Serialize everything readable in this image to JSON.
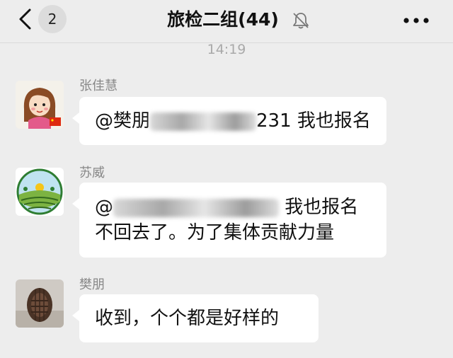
{
  "header": {
    "back_icon": "chevron-left-icon",
    "unread_count": "2",
    "title": "旅检二组(44)",
    "mute_icon": "bell-muted-icon",
    "more_icon": "more-dots-icon"
  },
  "chat": {
    "timestamp": "14:19",
    "messages": [
      {
        "sender": "张佳慧",
        "avatar_icon": "cartoon-girl-avatar",
        "text_prefix": "@樊朋",
        "text_suffix": "231 我也报名"
      },
      {
        "sender": "苏威",
        "avatar_icon": "farm-landscape-avatar",
        "text_prefix": "@",
        "text_line1_suffix": "我也报名",
        "text_line2": "不回去了。为了集体贡献力量"
      },
      {
        "sender": "樊朋",
        "avatar_icon": "basket-photo-avatar",
        "text": "收到，个个都是好样的"
      }
    ]
  }
}
